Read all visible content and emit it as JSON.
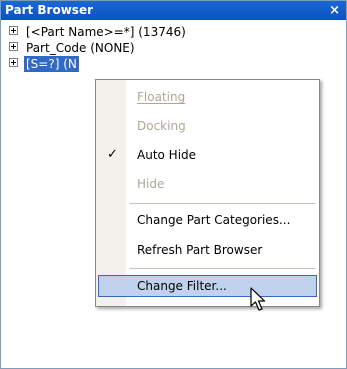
{
  "window": {
    "title": "Part Browser",
    "close_glyph": "×"
  },
  "tree": {
    "items": [
      {
        "label": "[<Part Name>=*] (13746)",
        "selected": false
      },
      {
        "label": "Part_Code (NONE)",
        "selected": false
      },
      {
        "label": "[S=?] (N",
        "selected": true
      }
    ]
  },
  "context_menu": {
    "items": [
      {
        "label": "Floating",
        "enabled": false,
        "checked": false
      },
      {
        "label": "Docking",
        "enabled": false,
        "checked": false
      },
      {
        "label": "Auto Hide",
        "enabled": true,
        "checked": true
      },
      {
        "label": "Hide",
        "enabled": false,
        "checked": false
      },
      {
        "label": "Change Part Categories...",
        "enabled": true,
        "checked": false
      },
      {
        "label": "Refresh Part Browser",
        "enabled": true,
        "checked": false
      },
      {
        "label": "Change Filter...",
        "enabled": true,
        "checked": false,
        "hovered": true
      }
    ],
    "check_glyph": "✓"
  },
  "colors": {
    "title_bar": "#0a52c2",
    "selection": "#316ac5",
    "menu_hover": "#c1d2ee",
    "disabled_text": "#aca899"
  },
  "icons": {
    "cursor": "arrow-pointer-icon",
    "expander": "plus-box-icon"
  }
}
